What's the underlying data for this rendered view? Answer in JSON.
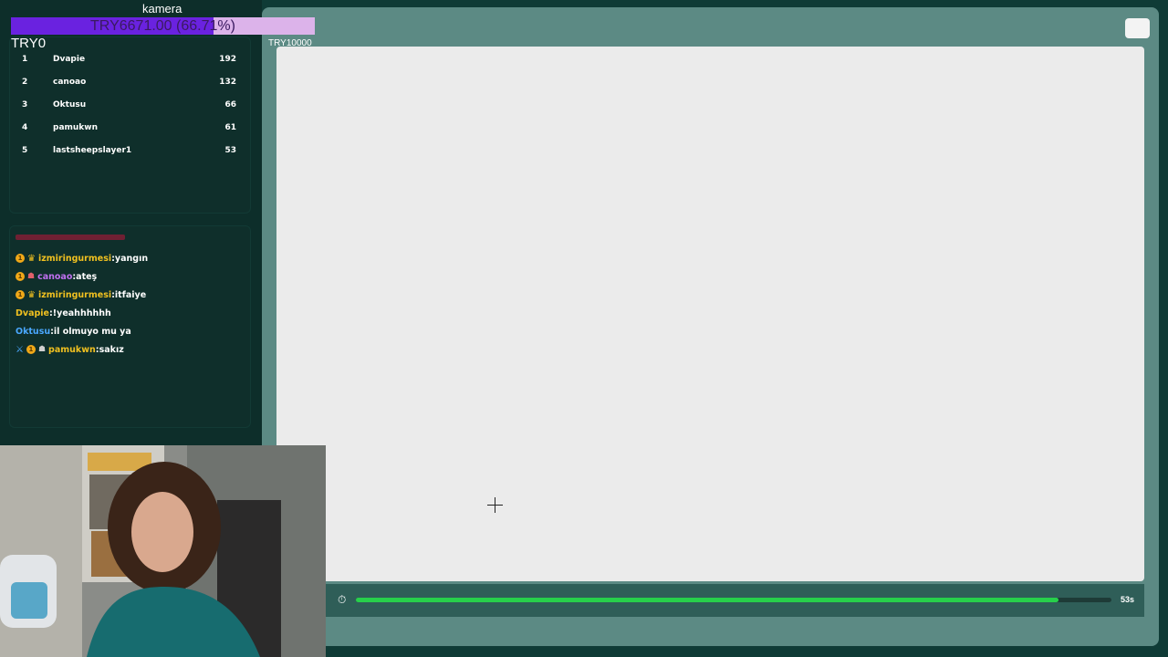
{
  "overlay": {
    "camera_label": "kamera",
    "goal_text": "TRY6671.00 (66.71%)",
    "goal_progress": 0.6671,
    "goal_current": "TRY0",
    "goal_target": "TRY10000",
    "goal_fill_color": "#6a22e0",
    "goal_bg_color": "#dcb3ea"
  },
  "leaderboard": {
    "rows": [
      {
        "rank": "1",
        "name": "Dvapie",
        "score": "192"
      },
      {
        "rank": "2",
        "name": "canoao",
        "score": "132"
      },
      {
        "rank": "3",
        "name": "Oktusu",
        "score": "66"
      },
      {
        "rank": "4",
        "name": "pamukwn",
        "score": "61"
      },
      {
        "rank": "5",
        "name": "lastsheepslayer1",
        "score": "53"
      }
    ]
  },
  "chat": {
    "messages": [
      {
        "user": "izmiringurmesi",
        "text": ":yangın",
        "user_color": "#f0c020",
        "badges": [
          "coin-icon",
          "crown-icon"
        ]
      },
      {
        "user": "canoao",
        "text": ":ateş",
        "user_color": "#c070f0",
        "badges": [
          "coin-icon",
          "bug-icon"
        ]
      },
      {
        "user": "izmiringurmesi",
        "text": ":itfaiye",
        "user_color": "#f0c020",
        "badges": [
          "coin-icon",
          "crown-icon"
        ]
      },
      {
        "user": "Dvapie",
        "text": ":!yeahhhhhh",
        "user_color": "#f0c020",
        "badges": []
      },
      {
        "user": "Oktusu",
        "text": ":il olmuyo mu ya",
        "user_color": "#4aa8ff",
        "badges": []
      },
      {
        "user": "pamukwn",
        "text": ":sakız",
        "user_color": "#f0c020",
        "badges": [
          "sword-icon",
          "coin-icon",
          "robot-icon"
        ]
      }
    ]
  },
  "game": {
    "timer_text": "53s",
    "timer_progress": 0.93,
    "progress_color": "#27d04b"
  }
}
